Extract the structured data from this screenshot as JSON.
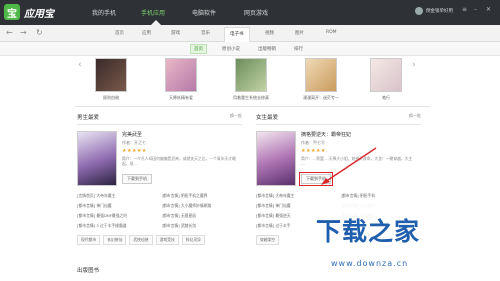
{
  "app": {
    "logo_char": "宝",
    "logo_text": "应用宝"
  },
  "top_nav": [
    "我的手机",
    "手机应用",
    "电脑软件",
    "网页游戏"
  ],
  "user": {
    "name": "倒金银单好用"
  },
  "categories": [
    "首页",
    "应用",
    "游戏",
    "音乐",
    "电子书",
    "视频",
    "图片",
    "ROM"
  ],
  "subcategories": [
    "首页",
    "原创小说",
    "出版畅销",
    "排行"
  ],
  "shelf": [
    "顾则由暗",
    "天降妖精有爱",
    "用着重生系统去修真",
    "漫漫离开：迷茫专一",
    "笔行"
  ],
  "left_section": {
    "title": "男生最爱",
    "more": "换一批",
    "featured": {
      "title": "完美武圣",
      "author": "作者：开之七",
      "stars": "★★★★★",
      "desc": "简介：一介凡人却因何偏偏是武神，或就失天之后，一个青年天才崛起，现…",
      "button": "下载到手机"
    },
    "list": [
      "[言情首页] 大帝年魔主",
      "[都市言情] 阴阳手机之魔界",
      "[都市言情] 神门仙魔",
      "[都市言情] 大小魔师妙情原路",
      "[都市言情] 最强DNF最强之时",
      "[都市言情] 无限星辰",
      "[都市言情] 3 过于丰手操霸道",
      "[都市言情] 武踏长剑"
    ],
    "tags": [
      "现代都市",
      "玄幻修仙",
      "武侠仙侠",
      "游戏竞技",
      "科幻灵异"
    ]
  },
  "right_section": {
    "title": "女生最爱",
    "more": "换一批",
    "featured": {
      "title": "摘格要逆天：霸帝狂妃",
      "author": "作者：甲七号",
      "stars": "★★★★★",
      "desc": "简介：…宵罢 …天降大小姐，她逆天改命，大龙！一朝穿越，大主 ...",
      "button": "下载到手机"
    },
    "list": [
      "[都市言情] 大帝年魔主",
      "[都市言情] 阴阳手机",
      "[都市言情] 神门仙魔",
      "[都市言情] 大小魔师",
      "[都市言情] 最强逆天",
      "[都市言情] 无限星辰",
      "[都市言情] 过于丰手",
      "[都市言情] 武踏长剑"
    ],
    "tags": [
      "穿越架空"
    ]
  },
  "pub_title": "出版图书",
  "watermark": {
    "main": "下载之家",
    "url": "www.downza.cn"
  },
  "colors": {
    "accent": "#7fd26b",
    "topbar": "#2e3136",
    "highlight": "#d9262a",
    "star": "#f5a623",
    "watermark": "#1f5fae"
  }
}
